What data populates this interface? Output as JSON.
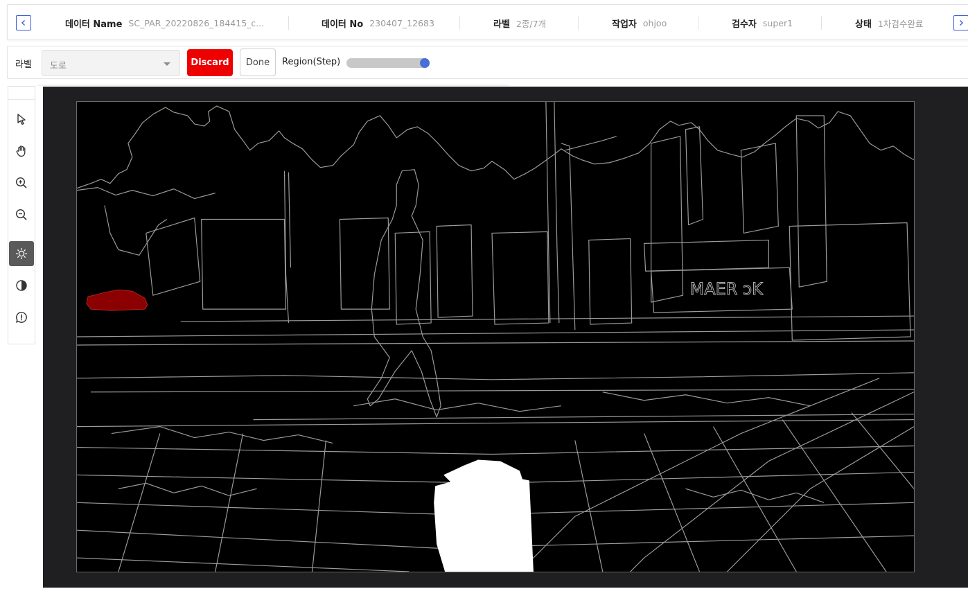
{
  "infobar": {
    "prev_icon": "chevron-left-icon",
    "next_icon": "chevron-right-icon",
    "fields": [
      {
        "key": "데이터 Name",
        "value": "SC_PAR_20220826_184415_c..."
      },
      {
        "key": "데이터 No",
        "value": "230407_12683"
      },
      {
        "key": "라벨",
        "value": "2종/7개"
      },
      {
        "key": "작업자",
        "value": "ohjoo"
      },
      {
        "key": "검수자",
        "value": "super1"
      },
      {
        "key": "상태",
        "value": "1차검수완료"
      }
    ]
  },
  "toolbar": {
    "label_title": "라벨",
    "label_select_value": "도로",
    "discard_label": "Discard",
    "done_label": "Done",
    "region_label": "Region(Step)",
    "region_value_fraction": 1.0
  },
  "tools": [
    {
      "name": "select-tool",
      "icon": "pointer-arrow-icon"
    },
    {
      "name": "pan-tool",
      "icon": "hand-icon"
    },
    {
      "name": "zoom-in-tool",
      "icon": "zoom-in-icon"
    },
    {
      "name": "zoom-out-tool",
      "icon": "zoom-out-icon"
    },
    {
      "name": "brightness-tool",
      "icon": "sun-icon",
      "active": true
    },
    {
      "name": "contrast-tool",
      "icon": "contrast-icon"
    },
    {
      "name": "comment-tool",
      "icon": "comment-alert-icon"
    }
  ],
  "brightness_value_fraction": 0.0,
  "image_overlay": {
    "overlay_text": "MAER ɔK",
    "colors": {
      "edges": "#9a9a9a",
      "car_mask": "#8b0000",
      "road_mask": "#ffffff"
    }
  },
  "colors": {
    "accent": "#3b5bdb",
    "discard": "#ee0000",
    "slider": "#4a6ed8",
    "canvas_bg": "#1f1f22"
  }
}
